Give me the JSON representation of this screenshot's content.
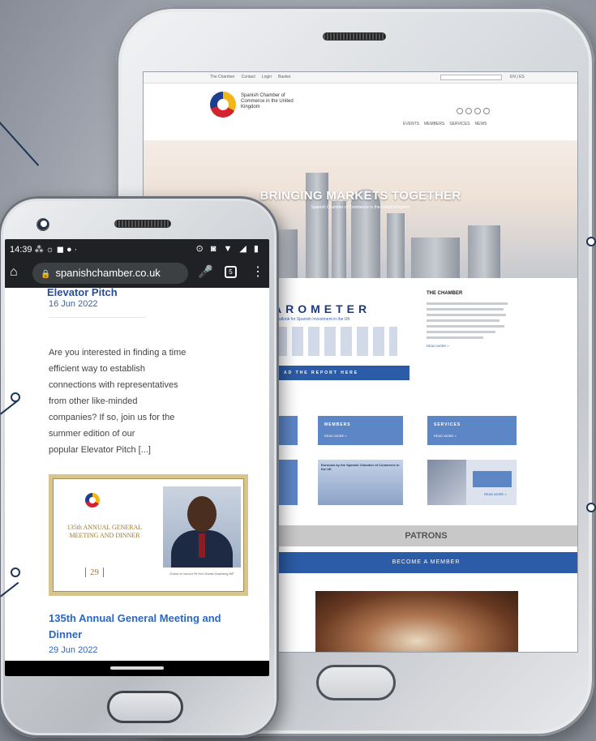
{
  "tablet": {
    "site": {
      "toplinks": [
        "The Chamber",
        "Contact",
        "Login",
        "Basket"
      ],
      "search_placeholder": "",
      "lang": "EN | ES",
      "logo_text": "Spanish Chamber of Commerce in the United Kingdom",
      "nav": [
        "EVENTS",
        "MEMBERS",
        "SERVICES",
        "NEWS"
      ],
      "hero_title": "BRINGING MARKETS TOGETHER",
      "hero_subtitle": "Spanish Chamber of Commerce in the United Kingdom",
      "barometer_title": "AROMETER",
      "barometer_subtitle": "Outlook for Spanish Investment in the UK",
      "barometer_button": "AD THE REPORT HERE",
      "chamber_heading": "THE CHAMBER",
      "chamber_readmore": "READ MORE »",
      "cards": [
        {
          "title": "MEMBERS",
          "more": "READ MORE »"
        },
        {
          "title": "SERVICES",
          "more": "READ MORE »"
        }
      ],
      "thumb_label": "Eurocam by the Spanish Chamber of Commerce in the UK",
      "thumb_more": "READ MORE »",
      "patrons": "PATRONS",
      "become_member": "BECOME A MEMBER"
    }
  },
  "phone": {
    "status": {
      "time": "14:39",
      "icons": "⊙ ◙ ▼ ◢ ▮"
    },
    "browser": {
      "url": "spanishchamber.co.uk"
    },
    "content": {
      "cut_title": "Elevator Pitch",
      "date1": "16 Jun 2022",
      "text_lines": [
        "Are you interested in finding a time",
        "efficient way to establish",
        "connections with representatives",
        "from other like-minded",
        "companies? If so, join us for the",
        "summer edition of our",
        "popular Elevator Pitch [...]"
      ],
      "invite_title": "135th ANNUAL GENERAL MEETING AND DINNER",
      "invite_date": "29",
      "invite_caption": "Guest of honour Rt Hon Kwasi Kwarteng MP",
      "article_title": "135th Annual General Meeting and Dinner",
      "date2": "29 Jun 2022"
    }
  }
}
